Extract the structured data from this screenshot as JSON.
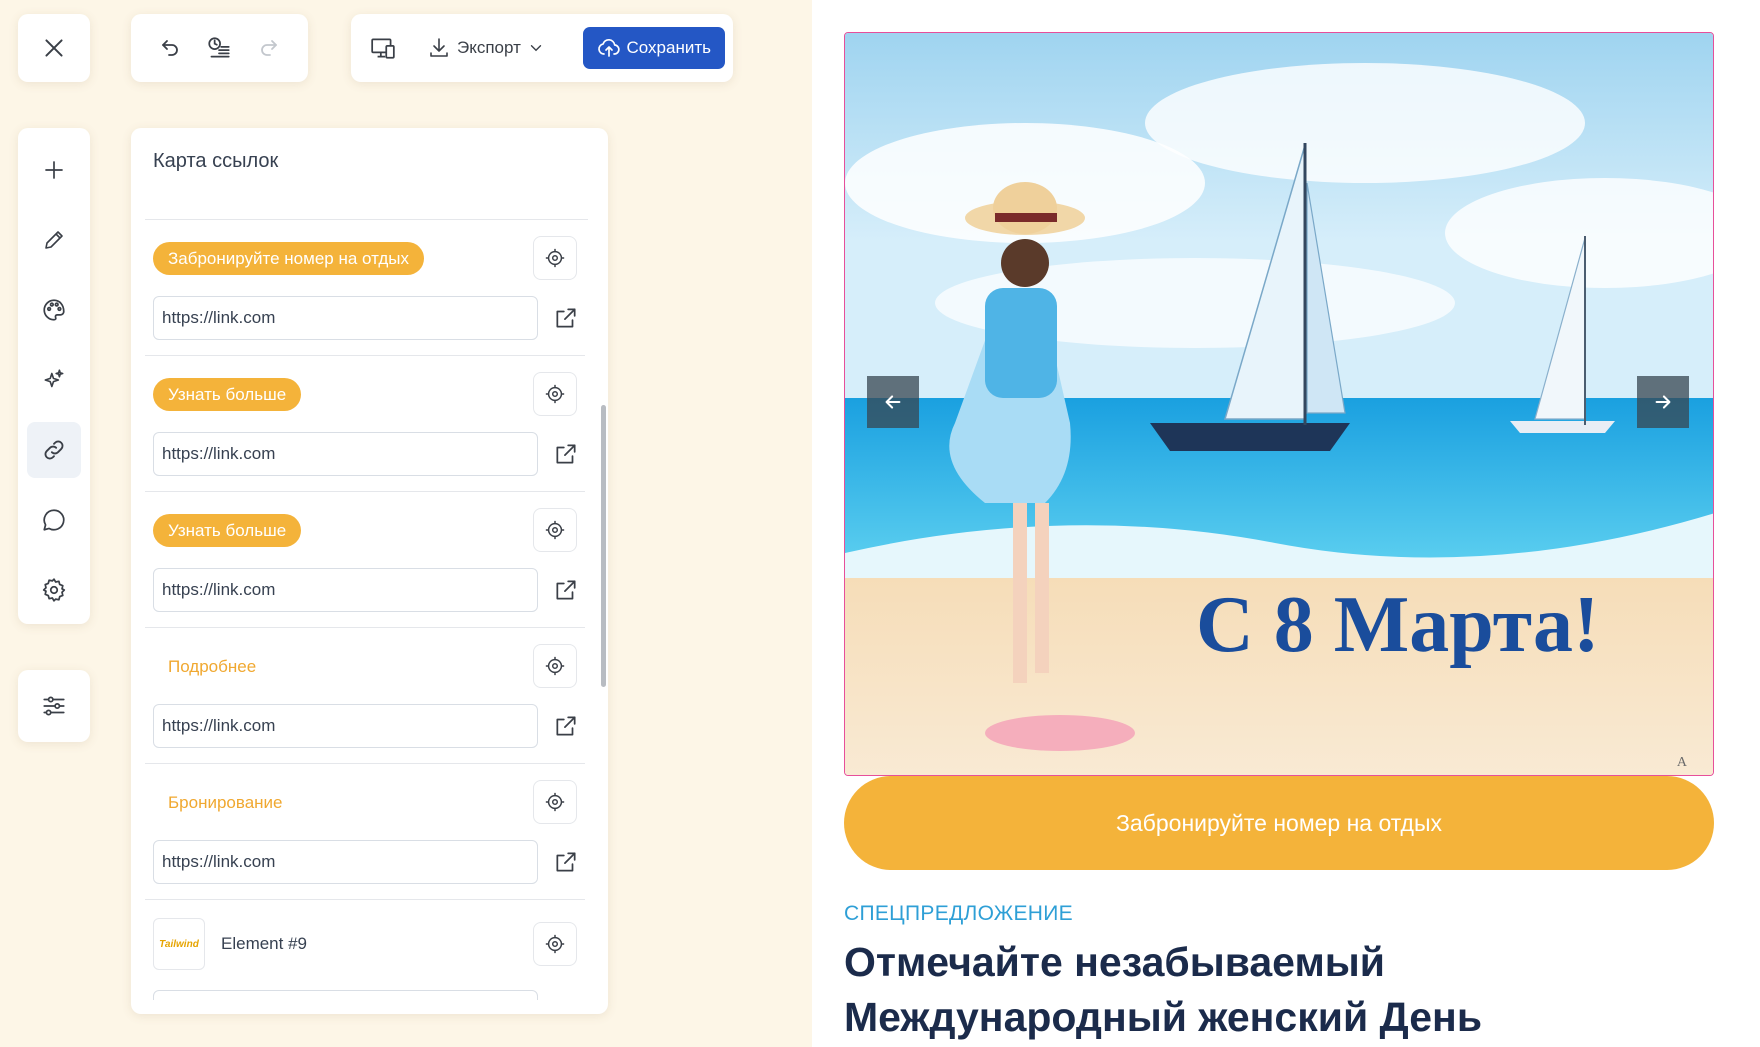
{
  "toolbar": {
    "export_label": "Экспорт",
    "save_label": "Сохранить"
  },
  "panel": {
    "title": "Карта ссылок",
    "links": [
      {
        "label": "Забронируйте номер на отдых",
        "style": "filled",
        "url": "https://link.com"
      },
      {
        "label": "Узнать больше",
        "style": "filled",
        "url": "https://link.com"
      },
      {
        "label": "Узнать больше",
        "style": "filled",
        "url": "https://link.com"
      },
      {
        "label": "Подробнее",
        "style": "plain",
        "url": "https://link.com"
      },
      {
        "label": "Бронирование",
        "style": "plain",
        "url": "https://link.com"
      }
    ],
    "element": {
      "thumb_text": "Tailwind",
      "name": "Element #9"
    }
  },
  "preview": {
    "hero_title": "С 8 Марта!",
    "cta_label": "Забронируйте номер на отдых",
    "kicker": "СПЕЦПРЕДЛОЖЕНИЕ",
    "headline": "Отмечайте незабываемый Международный женский День"
  },
  "colors": {
    "accent_orange": "#f4b33a",
    "save_blue": "#2457c5",
    "selection_pink": "#e74f9a",
    "headline_navy": "#1b2b4b",
    "kicker_blue": "#2e9fd6"
  }
}
